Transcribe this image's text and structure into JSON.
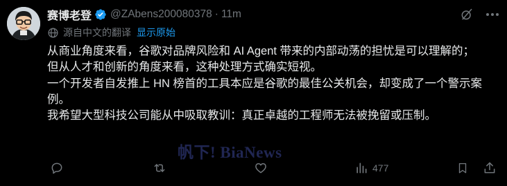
{
  "tweet": {
    "display_name": "赛博老登",
    "handle": "@ZAbens200080378",
    "separator": "·",
    "time": "11m",
    "translated_from": "源自中文的翻译",
    "show_original": "显示原始",
    "paragraphs": [
      "从商业角度来看，谷歌对品牌风险和 AI Agent 带来的内部动荡的担忧是可以理解的；",
      "但从人才和创新的角度来看，这种处理方式确实短视。",
      "一个开发者自发推上 HN 榜首的工具本应是谷歌的最佳公关机会，却变成了一个警示案例。",
      "我希望大型科技公司能从中吸取教训：真正卓越的工程师无法被挽留或压制。"
    ],
    "watermark": "帆下! BiaNews",
    "views": "477"
  },
  "icons": {
    "avatar": "cartoon-avatar",
    "verified": "verified-badge-icon",
    "grok": "grok-icon",
    "more": "more-options-icon",
    "translate": "globe-icon",
    "reply": "reply-icon",
    "repost": "repost-icon",
    "like": "like-icon",
    "views": "views-icon",
    "bookmark": "bookmark-icon",
    "share": "share-icon"
  },
  "colors": {
    "background": "#000000",
    "text_primary": "#e7e9ea",
    "text_secondary": "#71767b",
    "accent": "#1d9bf0"
  }
}
